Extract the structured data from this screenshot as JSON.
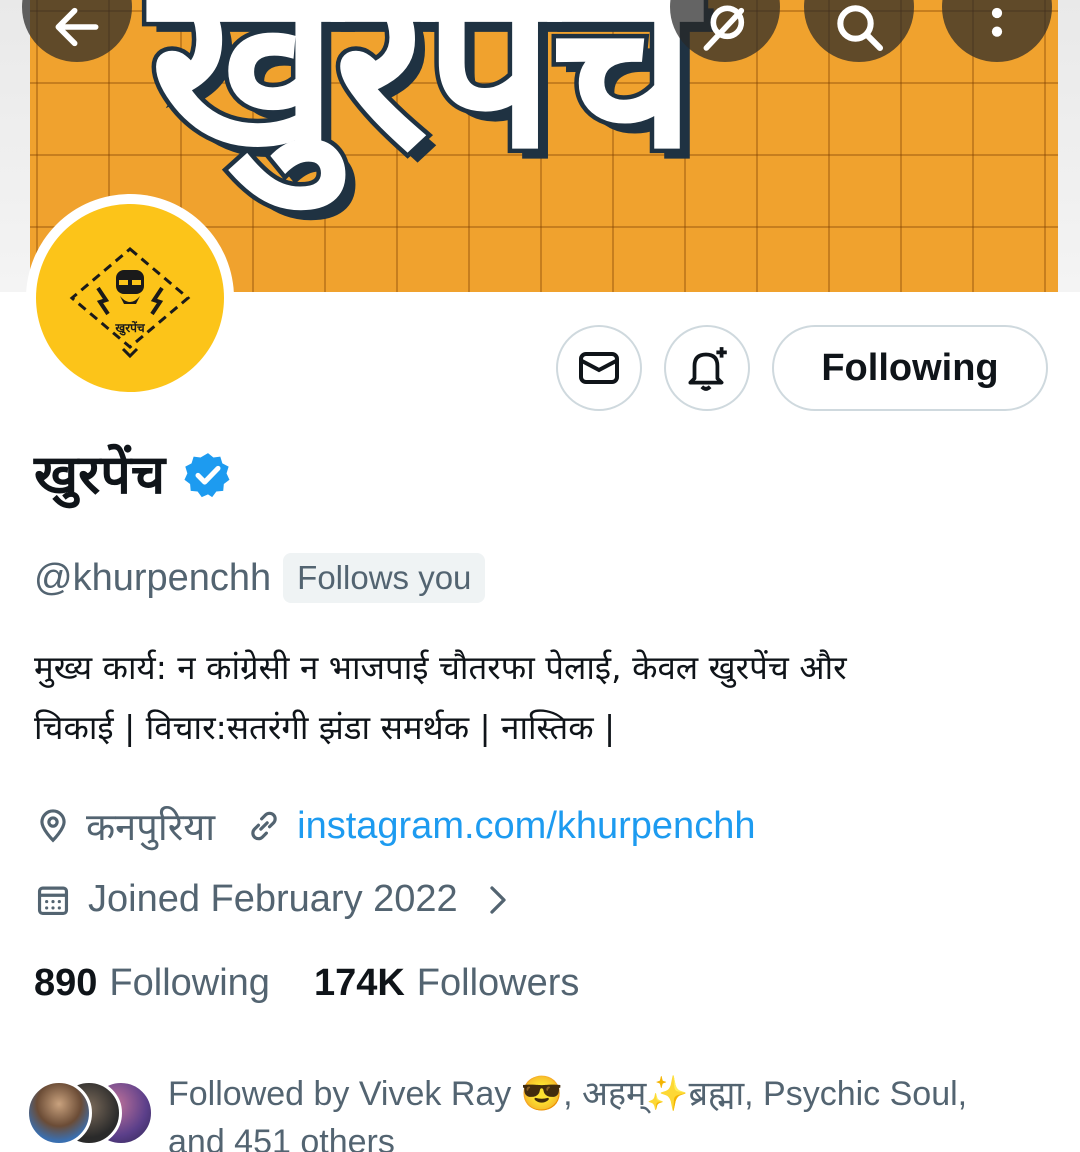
{
  "banner": {
    "word": "खुरपेंच",
    "back_icon": "arrow-left-icon",
    "translate_icon": "translate-icon",
    "search_icon": "search-icon",
    "more_icon": "more-vertical-icon"
  },
  "avatar": {
    "logo_text": "खुरपेंच"
  },
  "actions": {
    "message_icon": "envelope-icon",
    "notify_icon": "bell-plus-icon",
    "follow_label": "Following"
  },
  "profile": {
    "display_name": "खुरपेंच",
    "verified": true,
    "handle": "@khurpenchh",
    "follows_you": "Follows you",
    "bio_line1": "मुख्य कार्य: न कांग्रेसी न भाजपाई चौतरफा पेलाई, केवल खुरपेंच और",
    "bio_line2": "चिकाई | विचार:सतरंगी झंडा समर्थक | नास्तिक |",
    "location": "कनपुरिया",
    "website": "instagram.com/khurpenchh",
    "joined": "Joined February 2022"
  },
  "stats": {
    "following_count": "890",
    "following_label": "Following",
    "followers_count": "174K",
    "followers_label": "Followers"
  },
  "followed_by": {
    "line1": "Followed by Vivek Ray 😎, अहम्✨ब्रह्मा, Psychic Soul,",
    "line2": "and 451 others"
  },
  "colors": {
    "accent": "#1d9bf0",
    "banner_orange": "#f0a22e",
    "avatar_yellow": "#fcc419",
    "secondary_text": "#536471"
  }
}
